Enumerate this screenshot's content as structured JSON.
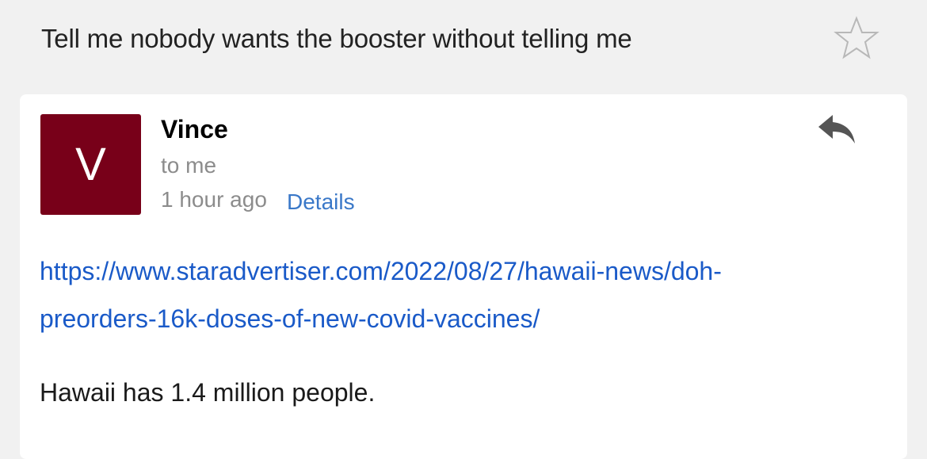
{
  "subject": "Tell me nobody wants the booster without telling me",
  "message": {
    "avatar_letter": "V",
    "avatar_color": "#780019",
    "sender": "Vince",
    "recipient": "to me",
    "time": "1 hour ago",
    "details_label": "Details",
    "link_line1": "https://www.staradvertiser.com/2022/08/27/hawaii-news/doh-",
    "link_line2": "preorders-16k-doses-of-new-covid-vaccines/",
    "body": "Hawaii has 1.4 million people."
  },
  "icons": {
    "star": "star-outline-icon",
    "reply": "reply-arrow-icon"
  }
}
